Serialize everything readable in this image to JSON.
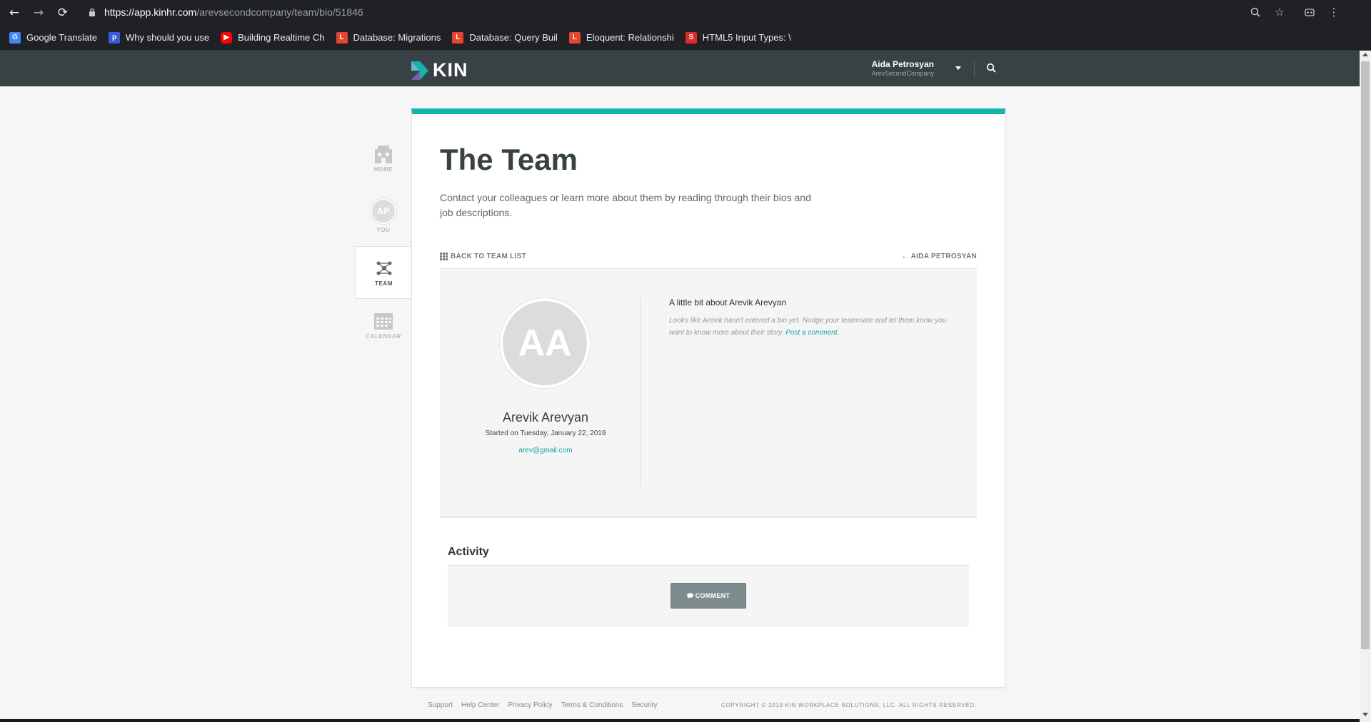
{
  "browser": {
    "url_host": "https://app.kinhr.com",
    "url_path": "/arevsecondcompany/team/bio/51846",
    "bookmarks": [
      {
        "label": "Google Translate",
        "icon": "google-translate-icon",
        "color": "#4285f4"
      },
      {
        "label": "Why should you use",
        "icon": "p-icon",
        "color": "#3b5bdb"
      },
      {
        "label": "Building Realtime Ch",
        "icon": "youtube-icon",
        "color": "#ff0000"
      },
      {
        "label": "Database: Migrations",
        "icon": "laravel-icon",
        "color": "#e74430"
      },
      {
        "label": "Database: Query Buil",
        "icon": "laravel-icon",
        "color": "#e74430"
      },
      {
        "label": "Eloquent: Relationshi",
        "icon": "laravel-icon",
        "color": "#e74430"
      },
      {
        "label": "HTML5 Input Types: \\",
        "icon": "s-icon",
        "color": "#e02b2b"
      }
    ]
  },
  "header": {
    "logo": "KIN",
    "user_name": "Aida Petrosyan",
    "company": "ArevSecondCompany",
    "accent": "#14b3ab"
  },
  "sidenav": {
    "home": "HOME",
    "you_initials": "AP",
    "you": "YOU",
    "team": "TEAM",
    "calendar": "CALENDAR"
  },
  "main": {
    "title": "The Team",
    "subtitle": "Contact your colleagues or learn more about them by reading through their bios and job descriptions.",
    "back_link": "BACK TO TEAM LIST",
    "prev_link": "AIDA PETROSYAN",
    "bio": {
      "initials": "AA",
      "name": "Arevik Arevyan",
      "started": "Started on Tuesday, January 22, 2019",
      "email": "arev@gmail.com",
      "about_title": "A little bit about Arevik Arevyan",
      "about_text": "Looks like Arevik hasn't entered a bio yet. Nudge your teammate and let them know you want to know more about their story.",
      "about_link": "Post a comment."
    },
    "activity": {
      "title": "Activity",
      "comment_button": "COMMENT"
    }
  },
  "footer": {
    "links": [
      "Support",
      "Help Center",
      "Privacy Policy",
      "Terms & Conditions",
      "Security"
    ],
    "copyright": "COPYRIGHT © 2019 KIN WORKPLACE SOLUTIONS, LLC. ALL RIGHTS RESERVED."
  }
}
